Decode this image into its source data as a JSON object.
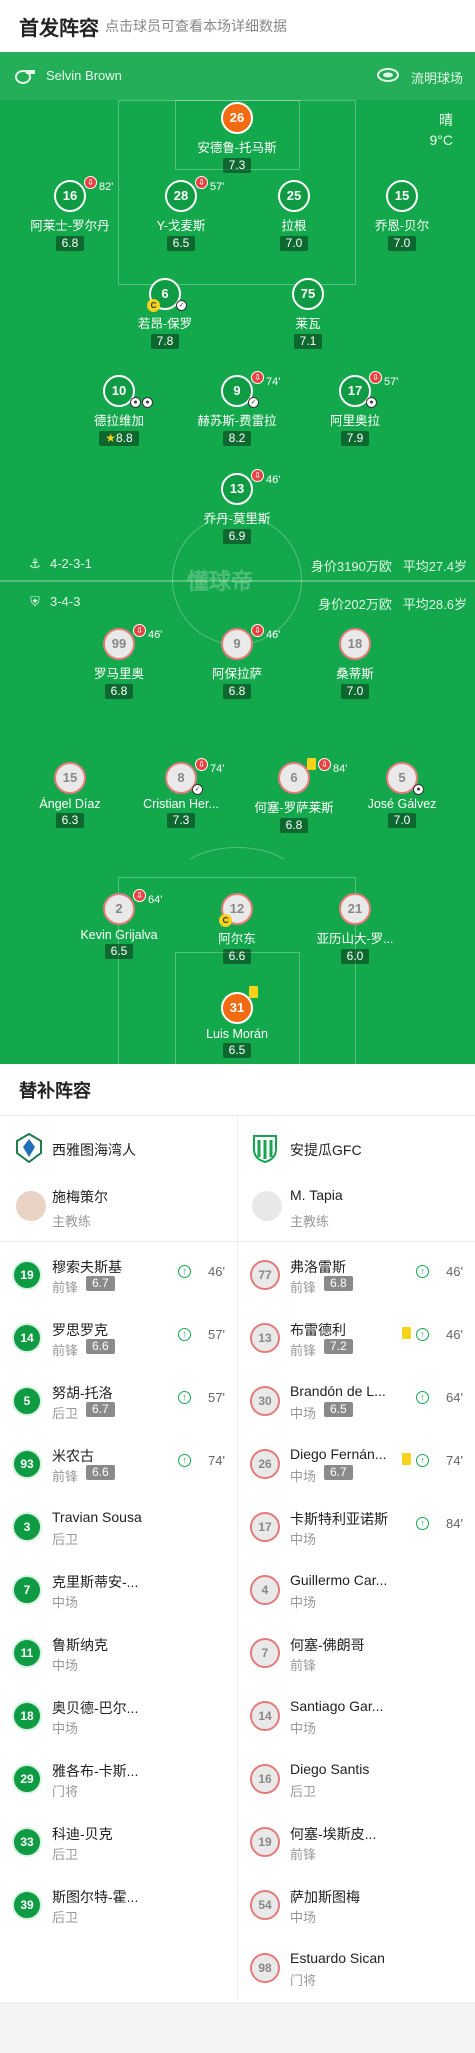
{
  "header": {
    "title": "首发阵容",
    "subtitle": "点击球员可查看本场详细数据"
  },
  "pitch": {
    "home_team": "Selvin Brown",
    "stadium": "流明球场",
    "weather": "晴",
    "temperature": "9°C",
    "home_formation": "4-2-3-1",
    "home_value": "身价3190万欧",
    "home_age": "平均27.4岁",
    "away_formation": "3-4-3",
    "away_value": "身价202万欧",
    "away_age": "平均28.6岁",
    "watermark": "懂球帝"
  },
  "home_players": [
    {
      "num": "26",
      "name": "安德鲁-托马斯",
      "rating": "7.3"
    },
    {
      "num": "16",
      "name": "阿莱士-罗尔丹",
      "rating": "6.8",
      "sub": "82'"
    },
    {
      "num": "28",
      "name": "Y-戈麦斯",
      "rating": "6.5",
      "sub": "57'"
    },
    {
      "num": "25",
      "name": "拉根",
      "rating": "7.0"
    },
    {
      "num": "15",
      "name": "乔恩-贝尔",
      "rating": "7.0"
    },
    {
      "num": "6",
      "name": "若昂-保罗",
      "rating": "7.8",
      "cap": "C"
    },
    {
      "num": "75",
      "name": "莱瓦",
      "rating": "7.1"
    },
    {
      "num": "10",
      "name": "德拉维加",
      "rating": "8.8"
    },
    {
      "num": "9",
      "name": "赫苏斯-费雷拉",
      "rating": "8.2",
      "sub": "74'"
    },
    {
      "num": "17",
      "name": "阿里奥拉",
      "rating": "7.9",
      "sub": "57'"
    },
    {
      "num": "13",
      "name": "乔丹-莫里斯",
      "rating": "6.9",
      "sub": "46'"
    }
  ],
  "away_players": [
    {
      "num": "99",
      "name": "罗马里奥",
      "rating": "6.8",
      "sub": "46'"
    },
    {
      "num": "9",
      "name": "阿保拉萨",
      "rating": "6.8",
      "sub": "46'"
    },
    {
      "num": "18",
      "name": "桑蒂斯",
      "rating": "7.0"
    },
    {
      "num": "15",
      "name": "Ángel Díaz",
      "rating": "6.3"
    },
    {
      "num": "8",
      "name": "Cristian Her...",
      "rating": "7.3",
      "sub": "74'"
    },
    {
      "num": "6",
      "name": "何塞-罗萨莱斯",
      "rating": "6.8",
      "sub": "84'"
    },
    {
      "num": "5",
      "name": "José Gálvez",
      "rating": "7.0"
    },
    {
      "num": "2",
      "name": "Kevin Grijalva",
      "rating": "6.5",
      "sub": "64'"
    },
    {
      "num": "12",
      "name": "阿尔东",
      "rating": "6.6",
      "cap": "C"
    },
    {
      "num": "21",
      "name": "亚历山大-罗...",
      "rating": "6.0"
    },
    {
      "num": "31",
      "name": "Luis Morán",
      "rating": "6.5"
    }
  ],
  "subs": {
    "title": "替补阵容",
    "home_team": "西雅图海湾人",
    "away_team": "安提瓜GFC",
    "home_coach": "施梅策尔",
    "away_coach": "M. Tapia",
    "coach_role": "主教练",
    "home": [
      {
        "num": "19",
        "name": "穆索夫斯基",
        "pos": "前锋",
        "rating": "6.7",
        "min": "46'"
      },
      {
        "num": "14",
        "name": "罗思罗克",
        "pos": "前锋",
        "rating": "6.6",
        "min": "57'"
      },
      {
        "num": "5",
        "name": "努胡-托洛",
        "pos": "后卫",
        "rating": "6.7",
        "min": "57'"
      },
      {
        "num": "93",
        "name": "米农古",
        "pos": "前锋",
        "rating": "6.6",
        "min": "74'"
      },
      {
        "num": "3",
        "name": "Travian Sousa",
        "pos": "后卫"
      },
      {
        "num": "7",
        "name": "克里斯蒂安-...",
        "pos": "中场"
      },
      {
        "num": "11",
        "name": "鲁斯纳克",
        "pos": "中场"
      },
      {
        "num": "18",
        "name": "奥贝德-巴尔...",
        "pos": "中场"
      },
      {
        "num": "29",
        "name": "雅各布-卡斯...",
        "pos": "门将"
      },
      {
        "num": "33",
        "name": "科迪-贝克",
        "pos": "后卫"
      },
      {
        "num": "39",
        "name": "斯图尔特-霍...",
        "pos": "后卫"
      }
    ],
    "away": [
      {
        "num": "77",
        "name": "弗洛雷斯",
        "pos": "前锋",
        "rating": "6.8",
        "min": "46'"
      },
      {
        "num": "13",
        "name": "布雷德利",
        "pos": "前锋",
        "rating": "7.2",
        "min": "46'",
        "yellow": true
      },
      {
        "num": "30",
        "name": "Brandón de L...",
        "pos": "中场",
        "rating": "6.5",
        "min": "64'"
      },
      {
        "num": "26",
        "name": "Diego Fernán...",
        "pos": "中场",
        "rating": "6.7",
        "min": "74'",
        "yellow": true
      },
      {
        "num": "17",
        "name": "卡斯特利亚诺斯",
        "pos": "中场",
        "min": "84'"
      },
      {
        "num": "4",
        "name": "Guillermo Car...",
        "pos": "中场"
      },
      {
        "num": "7",
        "name": "何塞-佛朗哥",
        "pos": "前锋"
      },
      {
        "num": "14",
        "name": "Santiago Gar...",
        "pos": "中场"
      },
      {
        "num": "16",
        "name": "Diego Santis",
        "pos": "后卫"
      },
      {
        "num": "19",
        "name": "何塞-埃斯皮...",
        "pos": "前锋"
      },
      {
        "num": "54",
        "name": "萨加斯图梅",
        "pos": "中场"
      },
      {
        "num": "98",
        "name": "Estuardo Sican",
        "pos": "门将"
      }
    ]
  }
}
